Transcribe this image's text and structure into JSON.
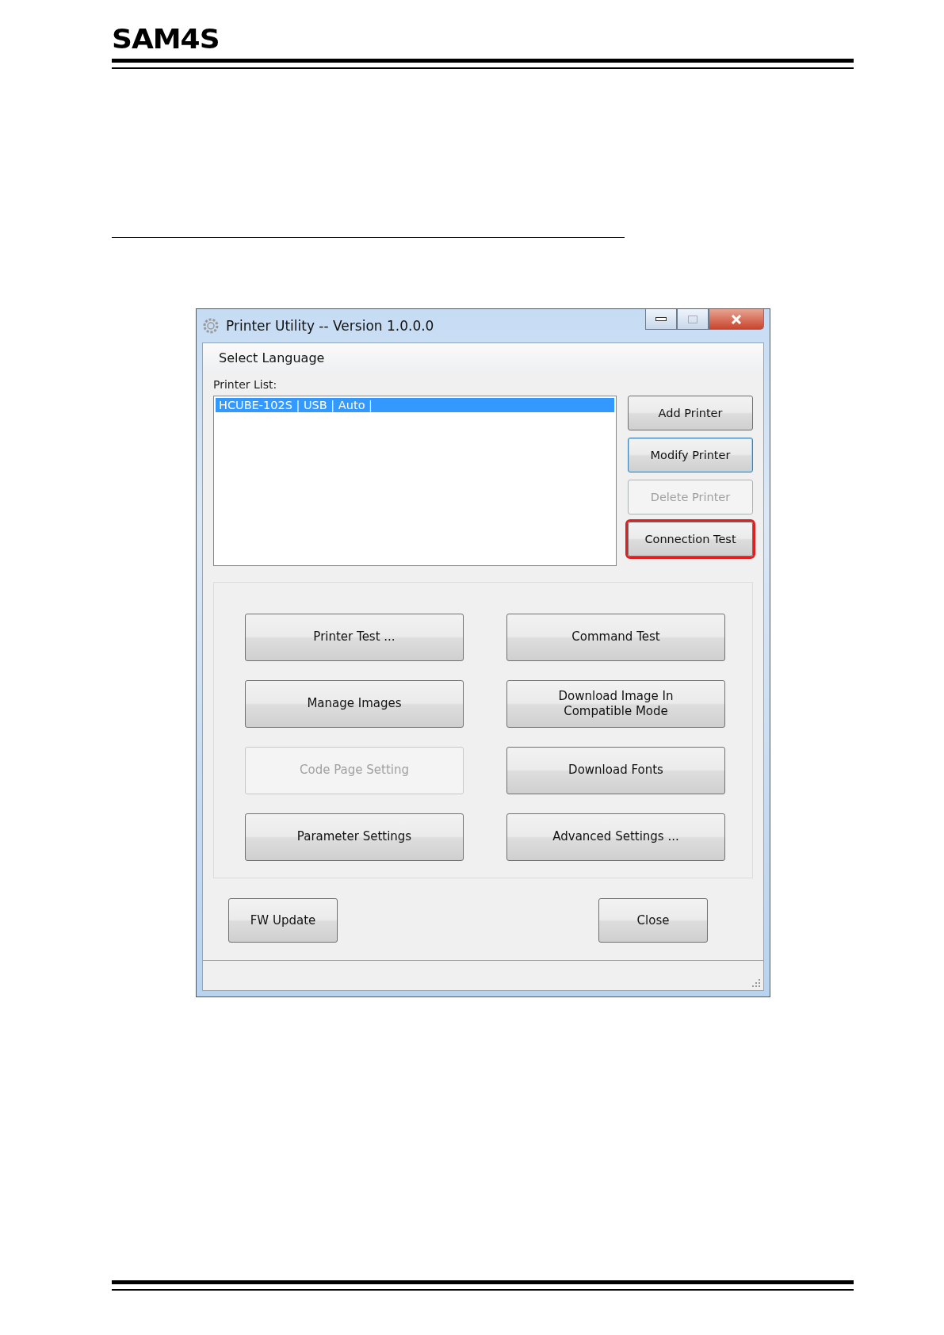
{
  "header": {
    "logo": "SAM4S"
  },
  "window": {
    "title": "Printer Utility -- Version 1.0.0.0",
    "menu": [
      "Select Language"
    ],
    "printer_list": {
      "label": "Printer List:",
      "rows": [
        {
          "text": "HCUBE-102S | USB | Auto |",
          "selected": true
        }
      ]
    },
    "side_buttons": [
      {
        "label": "Add Printer",
        "disabled": false,
        "focused": false,
        "highlighted": false
      },
      {
        "label": "Modify Printer",
        "disabled": false,
        "focused": true,
        "highlighted": false
      },
      {
        "label": "Delete Printer",
        "disabled": true,
        "focused": false,
        "highlighted": false
      },
      {
        "label": "Connection Test",
        "disabled": false,
        "focused": false,
        "highlighted": true
      }
    ],
    "function_buttons": [
      {
        "label": "Printer Test ...",
        "disabled": false
      },
      {
        "label": "Command Test",
        "disabled": false
      },
      {
        "label": "Manage Images",
        "disabled": false
      },
      {
        "label": "Download Image In Compatible Mode",
        "disabled": false
      },
      {
        "label": "Code Page Setting",
        "disabled": true
      },
      {
        "label": "Download Fonts",
        "disabled": false
      },
      {
        "label": "Parameter Settings",
        "disabled": false
      },
      {
        "label": "Advanced Settings ...",
        "disabled": false
      }
    ],
    "bottom_buttons": [
      "FW Update",
      "Close"
    ]
  }
}
